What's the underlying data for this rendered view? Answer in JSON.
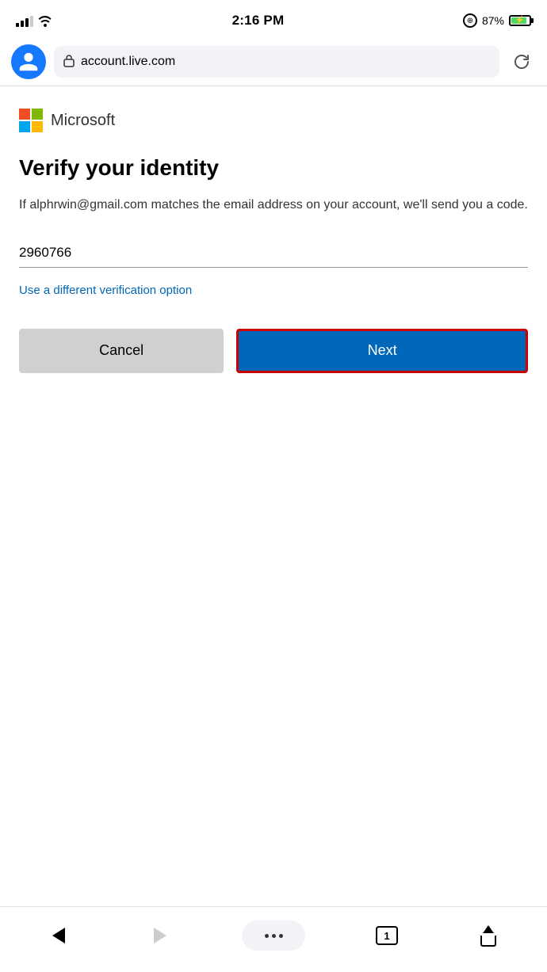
{
  "statusBar": {
    "time": "2:16 PM",
    "batteryPercent": "87%",
    "signalStrength": 3
  },
  "browserBar": {
    "url": "account.live.com",
    "refreshTitle": "Refresh"
  },
  "microsoftLogo": {
    "brandName": "Microsoft"
  },
  "page": {
    "title": "Verify your identity",
    "description": "If alphrwin@gmail.com matches the email address on your account, we'll send you a code.",
    "inputValue": "2960766",
    "altLinkText": "Use a different verification option",
    "cancelLabel": "Cancel",
    "nextLabel": "Next"
  },
  "bottomNav": {
    "backLabel": "Back",
    "forwardLabel": "Forward",
    "moreLabel": "More",
    "tabCount": "1",
    "shareLabel": "Share"
  }
}
